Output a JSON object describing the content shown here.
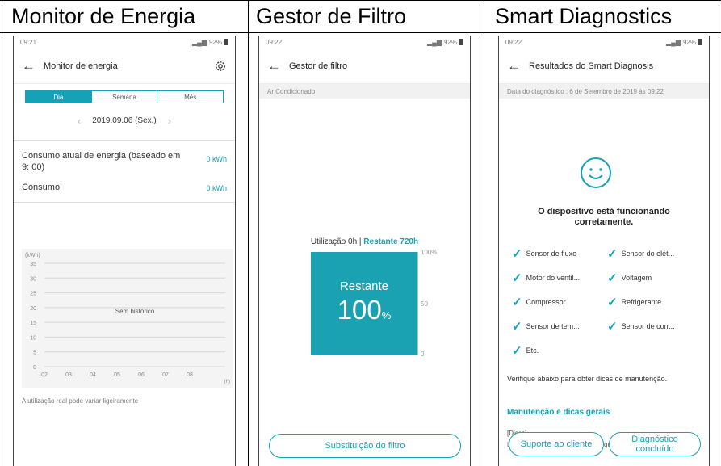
{
  "columns": {
    "energy": "Monitor de Energia",
    "filter": "Gestor de Filtro",
    "diag": "Smart Diagnostics"
  },
  "energy": {
    "status_time": "09:21",
    "status_battery": "92%",
    "title": "Monitor de energia",
    "tabs": [
      "Dia",
      "Semana",
      "Mês"
    ],
    "date": "2019.09.06 (Sex.)",
    "current_label": "Consumo atual de energia (baseado em 9: 00)",
    "current_value": "0 kWh",
    "consumption_label": "Consumo",
    "consumption_value": "0 kWh",
    "note": "A utilização real pode variar ligeiramente"
  },
  "filter": {
    "status_time": "09:22",
    "status_battery": "92%",
    "title": "Gestor de filtro",
    "device": "Ar Condicionado",
    "usage_label": "Utilização 0h | ",
    "remaining_label": "Restante 720h",
    "box_label": "Restante",
    "percent": "100",
    "percent_unit": "%",
    "ticks": [
      "100%",
      "50",
      "0"
    ],
    "remaining_fraction": 1.0,
    "button": "Substituição do filtro"
  },
  "diag": {
    "status_time": "09:22",
    "status_battery": "92%",
    "title": "Resultados do Smart Diagnosis",
    "date_line": "Data do diagnóstico : 6 de Setembro de 2019 às 09:22",
    "result_line1": "O dispositivo está funcionando",
    "result_line2": "corretamente.",
    "items": [
      "Sensor de fluxo",
      "Sensor do elét...",
      "Motor do ventil...",
      "Voltagem",
      "Compressor",
      "Refrigerante",
      "Sensor de tem...",
      "Sensor de corr...",
      "Etc."
    ],
    "hint": "Verifique abaixo para obter dicas de manutenção.",
    "section_title": "Manutenção e dicas gerais",
    "tip_tag": "[Dicas]",
    "tip_body": "Limpe o filtro regularmente e o troque conforme for necessário.",
    "btn_support": "Suporte ao cliente",
    "btn_done_1": "Diagnóstico",
    "btn_done_2": "concluído"
  },
  "chart_data": {
    "type": "bar",
    "ylabel": "(kWh)",
    "xlabel": "(h)",
    "categories": [
      "02",
      "03",
      "04",
      "05",
      "06",
      "07",
      "08"
    ],
    "values": [],
    "ylim": [
      0,
      35
    ],
    "yticks": [
      "35",
      "30",
      "25",
      "20",
      "15",
      "10",
      "5",
      "0"
    ],
    "empty_label": "Sem histórico"
  },
  "colors": {
    "accent": "#15a2b6",
    "filter_box": "#1aa2b3"
  }
}
